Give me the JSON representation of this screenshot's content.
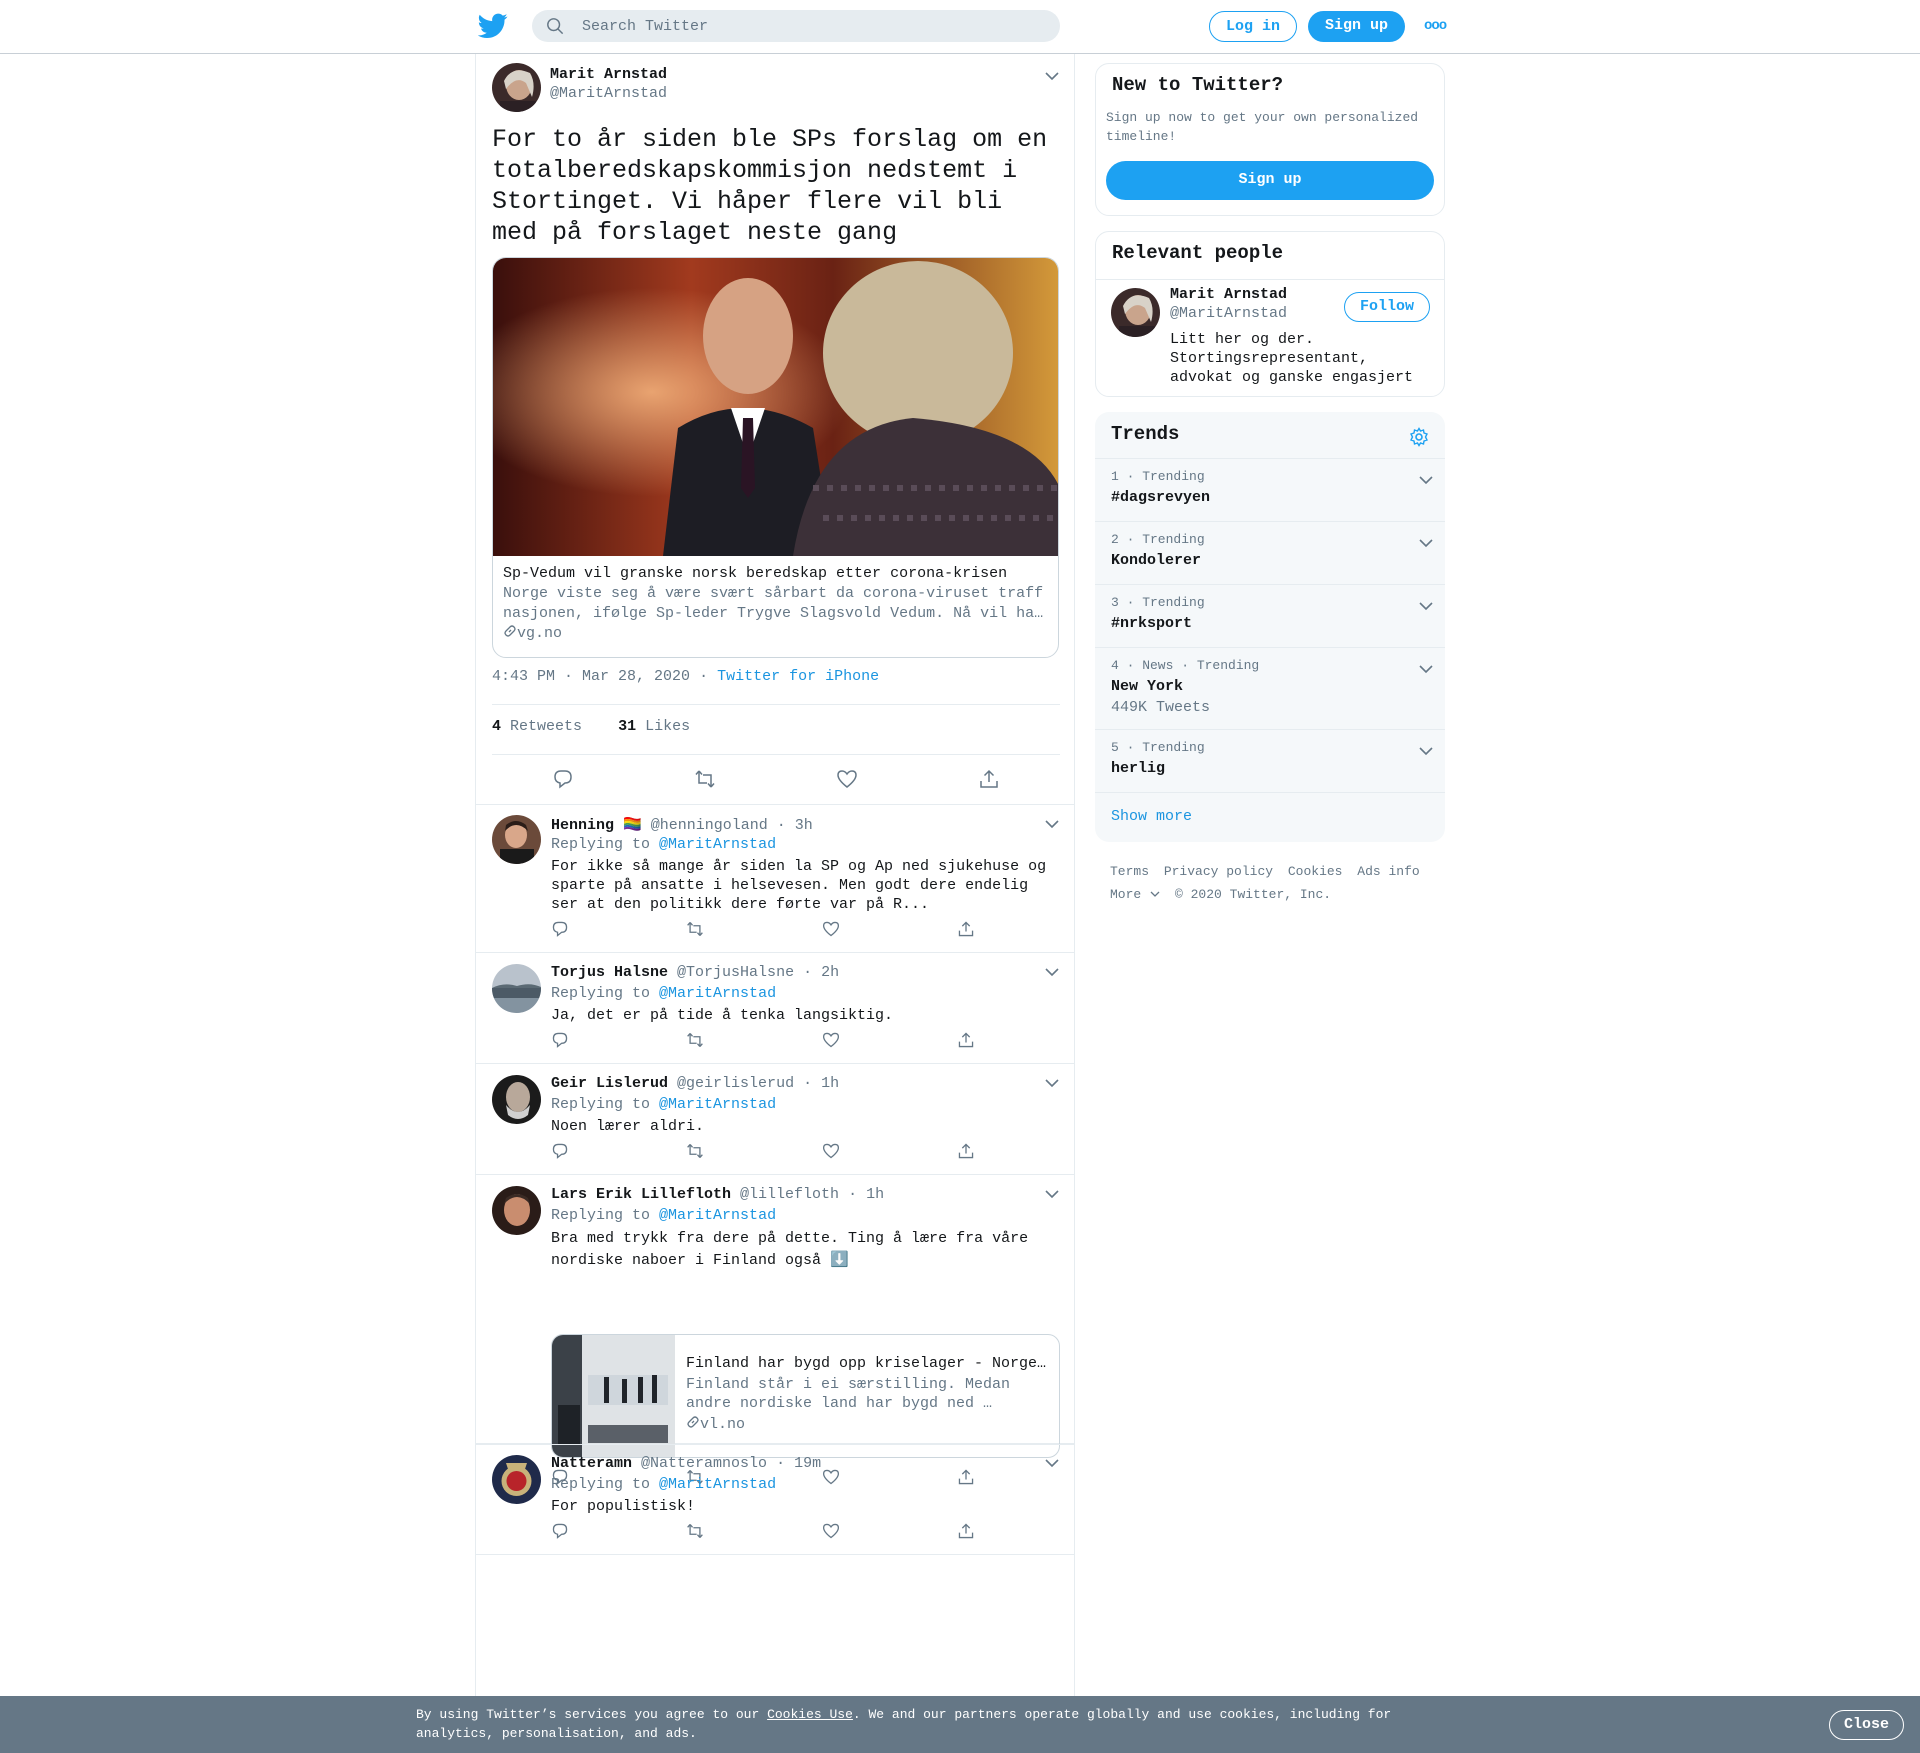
{
  "header": {
    "search_placeholder": "Search Twitter",
    "login_label": "Log in",
    "signup_label": "Sign up",
    "more_label": "ooo"
  },
  "tweet": {
    "name": "Marit Arnstad",
    "handle": "@MaritArnstad",
    "text": "For to år siden ble SPs forslag om en totalberedskapskommisjon nedstemt i Stortinget. Vi håper flere vil bli med på forslaget neste gang",
    "card": {
      "title": "Sp-Vedum vil granske norsk beredskap etter corona-krisen",
      "description": "Norge viste seg å være svært sårbart da corona-viruset traff nasjonen, ifølge Sp-leder Trygve Slagsvold Vedum. Nå vil ha…",
      "domain": "vg.no"
    },
    "time": "4:43 PM · Mar 28, 2020",
    "dot": "·",
    "source": "Twitter for iPhone",
    "retweets_count": "4",
    "retweets_label": "Retweets",
    "likes_count": "31",
    "likes_label": "Likes"
  },
  "replies": [
    {
      "name": "Henning",
      "emoji": "🏳️‍🌈",
      "handle": "@henningoland",
      "time": "· 3h",
      "replying_prefix": "Replying to",
      "replying_to": "@MaritArnstad",
      "text": "For ikke så mange år siden la SP og Ap ned sjukehuse og sparte på ansatte i helsevesen. Men godt dere endelig ser at den politikk dere førte var på R..."
    },
    {
      "name": "Torjus Halsne",
      "handle": "@TorjusHalsne",
      "time": "· 2h",
      "replying_prefix": "Replying to",
      "replying_to": "@MaritArnstad",
      "text": "Ja, det er på tide å tenka langsiktig."
    },
    {
      "name": "Geir Lislerud",
      "handle": "@geirlislerud",
      "time": "· 1h",
      "replying_prefix": "Replying to",
      "replying_to": "@MaritArnstad",
      "text": "Noen lærer aldri."
    },
    {
      "name": "Lars Erik Lillefloth",
      "handle": "@lillefloth",
      "time": "· 1h",
      "replying_prefix": "Replying to",
      "replying_to": "@MaritArnstad",
      "text": "Bra med trykk fra dere på dette. Ting å lære fra våre nordiske naboer i Finland også",
      "emoji": "⬇️",
      "card": {
        "title": "Finland har bygd opp kriselager - Norge…",
        "description": "Finland står i ei særstilling. Medan andre nordiske land har bygd ned …",
        "domain": "vl.no"
      }
    },
    {
      "name": "Natteramn",
      "handle": "@Natteramnoslo",
      "time": "· 19m",
      "replying_prefix": "Replying to",
      "replying_to": "@MaritArnstad",
      "text": "For populistisk!"
    }
  ],
  "sidebar": {
    "new_title": "New to Twitter?",
    "new_text": "Sign up now to get your own personalized timeline!",
    "signup_label": "Sign up",
    "relevant_title": "Relevant people",
    "person": {
      "name": "Marit Arnstad",
      "handle": "@MaritArnstad",
      "follow_label": "Follow",
      "bio": "Litt her og der. Stortingsrepresentant, advokat og ganske engasjert"
    },
    "trends_title": "Trends",
    "trends": [
      {
        "meta": "1 · Trending",
        "name": "#dagsrevyen"
      },
      {
        "meta": "2 · Trending",
        "name": "Kondolerer"
      },
      {
        "meta": "3 · Trending",
        "name": "#nrksport"
      },
      {
        "meta": "4 · News · Trending",
        "name": "New York",
        "count": "449K Tweets"
      },
      {
        "meta": "5 · Trending",
        "name": "herlig"
      }
    ],
    "show_more": "Show more",
    "footer": {
      "terms": "Terms",
      "privacy": "Privacy policy",
      "cookies": "Cookies",
      "ads": "Ads info",
      "more": "More",
      "copyright": "© 2020 Twitter, Inc."
    }
  },
  "cookie_bar": {
    "text_before": "By using Twitter’s services you agree to our",
    "link": "Cookies Use",
    "text_after": ". We and our partners operate globally and use cookies, including for analytics, personalisation, and ads.",
    "close_label": "Close"
  },
  "colors": {
    "accent": "#1da1f2",
    "link": "#1b95e0",
    "secondary_text": "#657786",
    "cookie_bar": "#657786"
  }
}
